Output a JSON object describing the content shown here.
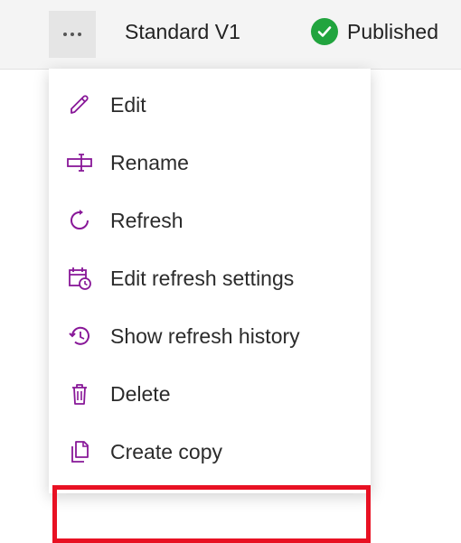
{
  "header": {
    "title": "Standard V1",
    "status_label": "Published"
  },
  "menu": {
    "items": [
      {
        "label": "Edit"
      },
      {
        "label": "Rename"
      },
      {
        "label": "Refresh"
      },
      {
        "label": "Edit refresh settings"
      },
      {
        "label": "Show refresh history"
      },
      {
        "label": "Delete"
      },
      {
        "label": "Create copy"
      }
    ]
  },
  "colors": {
    "icon_accent": "#881798",
    "status_green": "#21a43e",
    "highlight_red": "#e81123"
  }
}
